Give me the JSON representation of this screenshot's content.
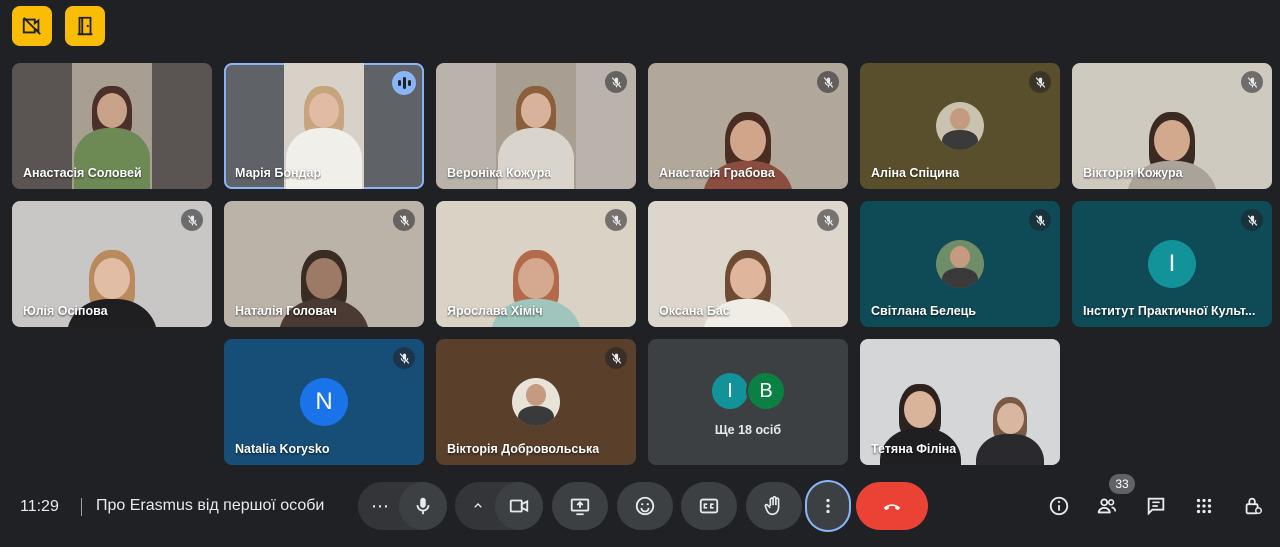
{
  "top_badges": [
    "no-video-icon",
    "door-icon"
  ],
  "tiles": [
    {
      "name": "Анастасія Соловей",
      "col": 0,
      "row": 0,
      "muted": false,
      "speaking": false,
      "kind": "video",
      "bg": "#5a5552",
      "person": {
        "skin": "#c9a28a",
        "hair": "#4a3028",
        "shirt": "#6d8a55"
      }
    },
    {
      "name": "Марія Бондар",
      "col": 1,
      "row": 0,
      "muted": false,
      "speaking": true,
      "kind": "video",
      "bg": "#5f6368",
      "person": {
        "skin": "#e1bba3",
        "hair": "#c7a47e",
        "shirt": "#f1efe9"
      }
    },
    {
      "name": "Вероніка Кожура",
      "col": 2,
      "row": 0,
      "muted": true,
      "speaking": false,
      "kind": "video",
      "bg": "#b9b3ab",
      "person": {
        "skin": "#d8b29a",
        "hair": "#8b5e3c",
        "shirt": "#d9d4cc"
      }
    },
    {
      "name": "Анастасія Грабова",
      "col": 3,
      "row": 0,
      "muted": true,
      "speaking": false,
      "kind": "video",
      "bg": "#b1a79b",
      "person": {
        "skin": "#d1a58a",
        "hair": "#4a2d22",
        "shirt": "#8a4d3f"
      }
    },
    {
      "name": "Аліна Спіцина",
      "col": 4,
      "row": 0,
      "muted": true,
      "speaking": false,
      "kind": "photo",
      "bg": "#5a4f2c",
      "avatar_bg": "#c9c2b0"
    },
    {
      "name": "Вікторія Кожура",
      "col": 5,
      "row": 0,
      "muted": true,
      "speaking": false,
      "kind": "video",
      "bg": "#cfcac0",
      "person": {
        "skin": "#d3a98e",
        "hair": "#3b2a22",
        "shirt": "#a9a39a"
      }
    },
    {
      "name": "Юлія Осіпова",
      "col": 0,
      "row": 1,
      "muted": true,
      "speaking": false,
      "kind": "video",
      "bg": "#c9c7c6",
      "person": {
        "skin": "#e2bda5",
        "hair": "#b98a5b",
        "shirt": "#1f1f22"
      }
    },
    {
      "name": "Наталія Головач",
      "col": 1,
      "row": 1,
      "muted": true,
      "speaking": false,
      "kind": "video",
      "bg": "#bcb3a8",
      "person": {
        "skin": "#9c7a66",
        "hair": "#3a2b24",
        "shirt": "#4a3a33"
      }
    },
    {
      "name": "Ярослава Хіміч",
      "col": 2,
      "row": 1,
      "muted": true,
      "speaking": false,
      "kind": "video",
      "bg": "#d9d2c5",
      "person": {
        "skin": "#d5a98f",
        "hair": "#b36a4a",
        "shirt": "#9fc5bc"
      }
    },
    {
      "name": "Оксана Бас",
      "col": 3,
      "row": 1,
      "muted": true,
      "speaking": false,
      "kind": "video",
      "bg": "#dcd6cc",
      "person": {
        "skin": "#dfb59c",
        "hair": "#6d4c33",
        "shirt": "#f0ede6"
      }
    },
    {
      "name": "Світлана Белець",
      "col": 4,
      "row": 1,
      "muted": true,
      "speaking": false,
      "kind": "photo",
      "bg": "#0f4a57",
      "avatar_bg": "#6f8d67"
    },
    {
      "name": "Інститут Практичної Культ...",
      "col": 5,
      "row": 1,
      "muted": true,
      "speaking": false,
      "kind": "letter",
      "letter": "I",
      "bg": "#0f4a57",
      "avatar_bg": "#12939a"
    },
    {
      "name": "Natalia Korysko",
      "col": 1,
      "row": 2,
      "muted": true,
      "speaking": false,
      "kind": "letter",
      "letter": "N",
      "bg": "#174e78",
      "avatar_bg": "#1a73e8"
    },
    {
      "name": "Вікторія Добровольська",
      "col": 2,
      "row": 2,
      "muted": true,
      "speaking": false,
      "kind": "photo",
      "bg": "#5a3f2a",
      "avatar_bg": "#e8e2d8"
    },
    {
      "name": "Тетяна Філіна",
      "col": 4,
      "row": 2,
      "muted": false,
      "speaking": false,
      "kind": "video2",
      "bg": "#d4d6d8"
    }
  ],
  "more_tile": {
    "label": "Ще 18 осіб",
    "avatars": [
      {
        "letter": "I",
        "color": "#12939a"
      },
      {
        "letter": "B",
        "color": "#0b8043"
      }
    ]
  },
  "bottom_bar": {
    "time": "11:29",
    "meeting_title": "Про Erasmus від першої особи",
    "participants_count": "33",
    "colors": {
      "button": "#3c4043",
      "end": "#ea4335",
      "accent": "#8ab4f8"
    }
  }
}
